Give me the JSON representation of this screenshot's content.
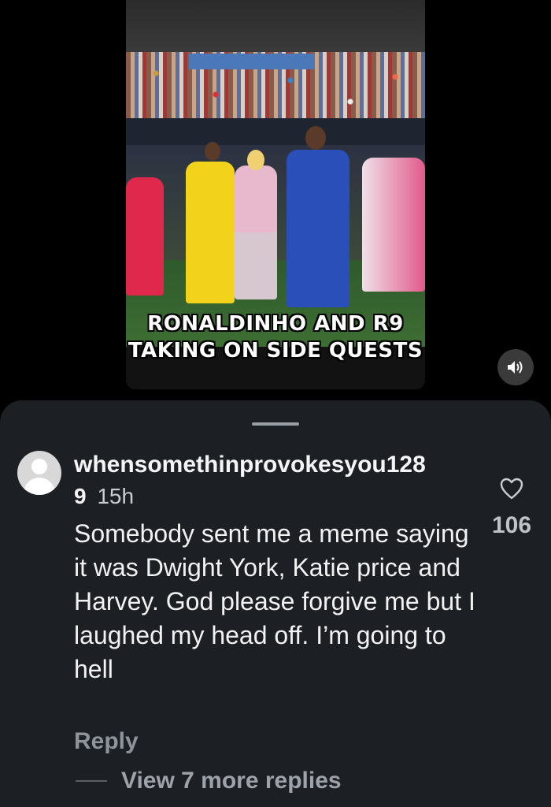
{
  "video": {
    "caption_line1": "RONALDINHO AND R9",
    "caption_line2": "TAKING ON SIDE QUESTS",
    "sound_icon": "speaker-icon"
  },
  "comment": {
    "username_line1": "whensomethinprovokesyou128",
    "username_line2": "9",
    "time": "15h",
    "text": "Somebody sent me a meme saying it was Dwight York, Katie price and Harvey. God please forgive me but I laughed my head off. I’m going to hell",
    "like_icon": "heart-icon",
    "like_count": "106",
    "reply_label": "Reply",
    "view_replies_label": "View 7 more replies"
  },
  "colors": {
    "background": "#000000",
    "sheet": "#1c1f24",
    "text_primary": "#f5f5f5",
    "text_secondary": "#8e949b"
  }
}
